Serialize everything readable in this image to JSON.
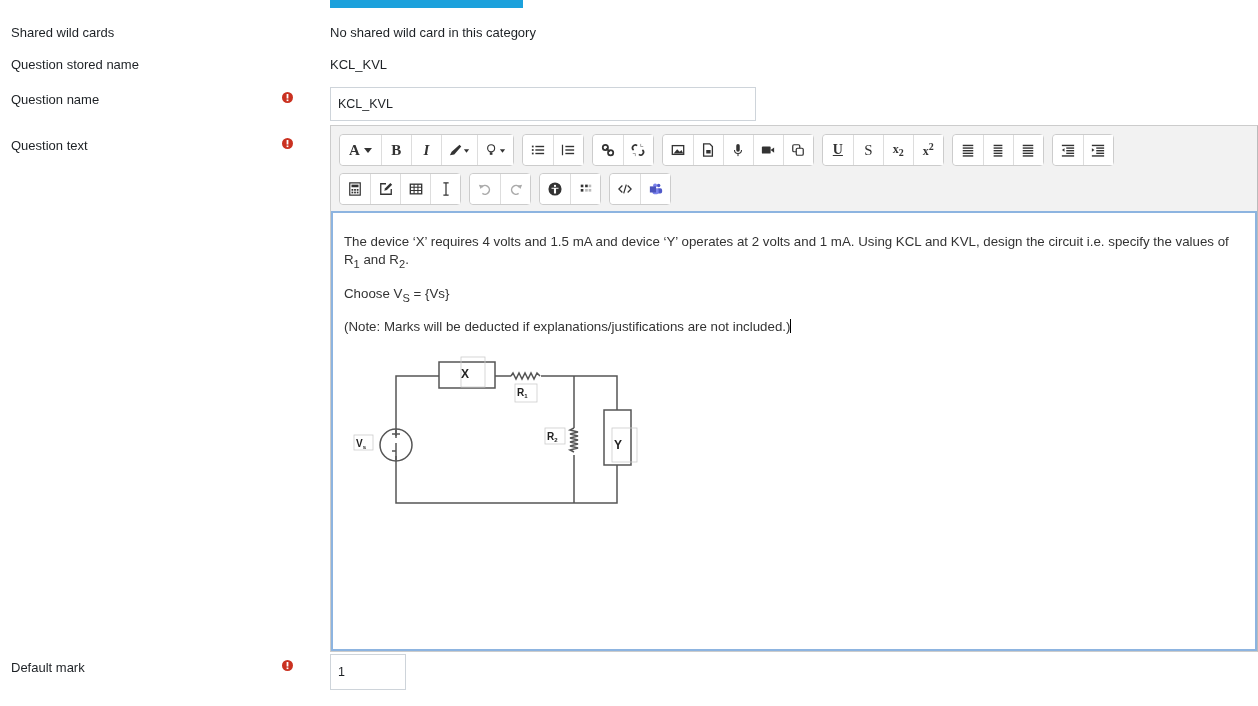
{
  "fields": [
    {
      "kind": "static",
      "label": "Shared wild cards",
      "required": false,
      "value": "No shared wild card in this category"
    },
    {
      "kind": "static",
      "label": "Question stored name",
      "required": false,
      "value": "KCL_KVL"
    },
    {
      "kind": "input",
      "label": "Question name",
      "required": true,
      "value": "KCL_KVL"
    },
    {
      "kind": "editor",
      "label": "Question text",
      "required": true
    },
    {
      "kind": "short_input",
      "label": "Default mark",
      "required": true,
      "value": "1"
    }
  ],
  "toolbar": {
    "labels": {
      "font": "A",
      "bold": "B",
      "italic": "I",
      "underline": "U",
      "strike": "S",
      "subscript": "x$_{2}$",
      "superscript": "x$^{2}$"
    },
    "disabled": {
      "undo": true,
      "redo": true
    }
  },
  "editor_content": {
    "paragraphs": [
      "The device ‘X’ requires 4 volts and 1.5 mA and device ‘Y’ operates at 2 volts and 1 mA. Using KCL and KVL, design the circuit i.e. specify the values of R$_{1}$ and R$_{2}$.",
      "Choose V$_{S}$ = {Vs}",
      "(Note: Marks will be deducted if explanations/justifications are not included.)"
    ],
    "circuit_labels": [
      {
        "main": "X"
      },
      {
        "main": "R",
        "sub": "1"
      },
      {
        "main": "R",
        "sub": "2"
      },
      {
        "main": "Y"
      },
      {
        "main": "V",
        "sub": "s"
      }
    ]
  }
}
